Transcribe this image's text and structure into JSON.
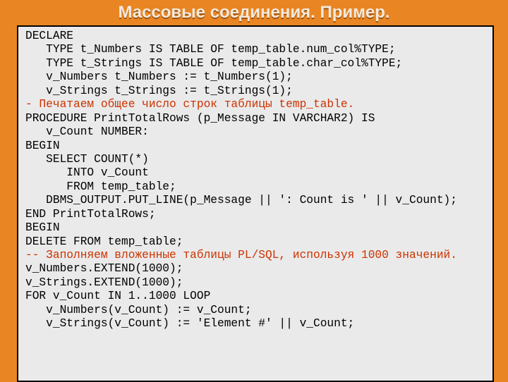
{
  "title": "Массовые соединения. Пример.",
  "code": {
    "l01": "DECLARE",
    "l02": "   TYPE t_Numbers IS TABLE OF temp_table.num_col%TYPE;",
    "l03": "   TYPE t_Strings IS TABLE OF temp_table.char_col%TYPE;",
    "l04": "   v_Numbers t_Numbers := t_Numbers(1);",
    "l05": "   v_Strings t_Strings := t_Strings(1);",
    "l06": "- Печатаем общее число строк таблицы temp_table.",
    "l07": "PROCEDURE PrintTotalRows (p_Message IN VARCHAR2) IS",
    "l08": "   v_Count NUMBER:",
    "l09": "BEGIN",
    "l10": "   SELECT COUNT(*)",
    "l11": "      INTO v_Count",
    "l12": "      FROM temp_table;",
    "l13": "   DBMS_OUTPUT.PUT_LINE(p_Message || ': Count is ' || v_Count);",
    "l14": "END PrintTotalRows;",
    "l15": "BEGIN",
    "l16": "DELETE FROM temp_table;",
    "l17": "-- Заполняем вложенные таблицы PL/SQL, используя 1000 значений.",
    "l18": "v_Numbers.EXTEND(1000);",
    "l19": "v_Strings.EXTEND(1000);",
    "l20": "FOR v_Count IN 1..1000 LOOP",
    "l21": "   v_Numbers(v_Count) := v_Count;",
    "l22": "   v_Strings(v_Count) := 'Element #' || v_Count;"
  }
}
